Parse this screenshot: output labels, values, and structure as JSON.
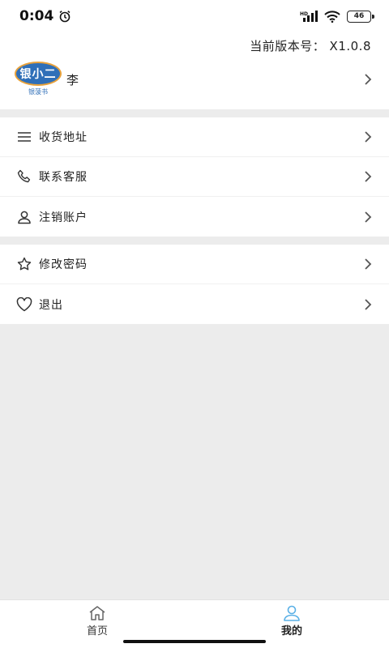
{
  "status": {
    "time": "0:04",
    "net": "HD",
    "battery": "46"
  },
  "header": {
    "version_text": "当前版本号： X1.0.8",
    "logo_text": "银小二",
    "logo_sub": "银菠书",
    "user_name": "李"
  },
  "menu_group_1": [
    {
      "label": "收货地址",
      "icon": "menu-lines-icon"
    },
    {
      "label": "联系客服",
      "icon": "phone-icon"
    },
    {
      "label": "注销账户",
      "icon": "user-icon"
    }
  ],
  "menu_group_2": [
    {
      "label": "修改密码",
      "icon": "star-icon"
    },
    {
      "label": "退出",
      "icon": "heart-icon"
    }
  ],
  "tabs": [
    {
      "label": "首页",
      "icon": "home-icon",
      "active": false
    },
    {
      "label": "我的",
      "icon": "profile-icon",
      "active": true
    }
  ],
  "colors": {
    "accent": "#5ab0e6",
    "brand": "#2f6fb8",
    "bg": "#ececec"
  }
}
